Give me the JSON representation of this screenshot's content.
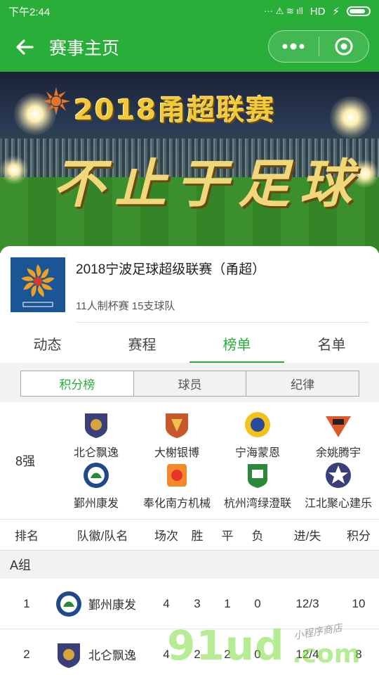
{
  "status_bar": {
    "time": "下午2:44",
    "signal_icons": "··· ⚠ ≋ ıll",
    "network": "HD"
  },
  "nav": {
    "title": "赛事主页",
    "back_icon": "arrow-left-icon",
    "menu_icon": "more-dots-icon",
    "close_icon": "target-circle-icon"
  },
  "banner": {
    "title": "2018甬超联赛",
    "slogan": "不止于足球"
  },
  "league": {
    "name": "2018宁波足球超级联赛（甬超）",
    "meta": "11人制杯赛 15支球队"
  },
  "tabs": [
    {
      "label": "动态"
    },
    {
      "label": "赛程"
    },
    {
      "label": "榜单"
    },
    {
      "label": "名单"
    }
  ],
  "active_tab": "榜单",
  "subtabs": [
    {
      "label": "积分榜"
    },
    {
      "label": "球员"
    },
    {
      "label": "纪律"
    }
  ],
  "qualified": {
    "label": "8强",
    "teams": [
      {
        "name": "北仑飘逸"
      },
      {
        "name": "大榭银博"
      },
      {
        "name": "宁海蒙恩"
      },
      {
        "name": "余姚腾宇"
      },
      {
        "name": "鄞州康发"
      },
      {
        "name": "奉化南方机械"
      },
      {
        "name": "杭州湾绿澄联"
      },
      {
        "name": "江北聚心建乐"
      }
    ]
  },
  "table": {
    "headers": {
      "rank": "排名",
      "team": "队徽/队名",
      "played": "场次",
      "win": "胜",
      "draw": "平",
      "loss": "负",
      "goals": "进/失",
      "points": "积分"
    },
    "group": "A组",
    "rows": [
      {
        "rank": "1",
        "team": "鄞州康发",
        "played": "4",
        "win": "3",
        "draw": "1",
        "loss": "0",
        "goals": "12/3",
        "points": "10"
      },
      {
        "rank": "2",
        "team": "北仑飘逸",
        "played": "4",
        "win": "2",
        "draw": "2",
        "loss": "0",
        "goals": "12/4",
        "points": "8"
      }
    ]
  },
  "watermark": {
    "main": "91ud",
    "domain": ".com",
    "tagline": "小程序商店"
  },
  "colors": {
    "primary": "#2aae3a",
    "background": "#f2f2f2",
    "text": "#333333"
  }
}
